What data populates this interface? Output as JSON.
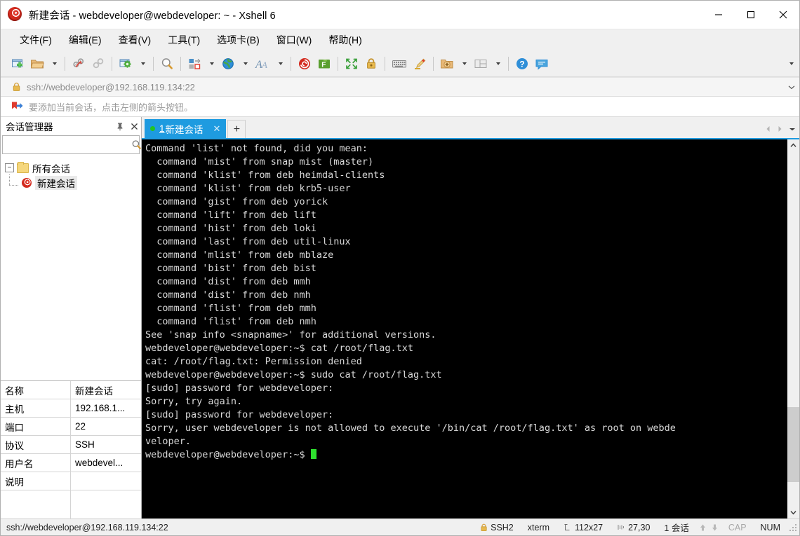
{
  "window": {
    "title": "新建会话 - webdeveloper@webdeveloper: ~ - Xshell 6",
    "app_icon": "xshell-spiral-icon",
    "minimize_label": "最小化",
    "maximize_label": "最大化",
    "close_label": "关闭"
  },
  "menubar": {
    "items": [
      {
        "label": "文件(F)",
        "name": "menu-file"
      },
      {
        "label": "编辑(E)",
        "name": "menu-edit"
      },
      {
        "label": "查看(V)",
        "name": "menu-view"
      },
      {
        "label": "工具(T)",
        "name": "menu-tools"
      },
      {
        "label": "选项卡(B)",
        "name": "menu-tabs"
      },
      {
        "label": "窗口(W)",
        "name": "menu-window"
      },
      {
        "label": "帮助(H)",
        "name": "menu-help"
      }
    ]
  },
  "toolbar": {
    "buttons": [
      {
        "name": "new-session-icon",
        "tooltip": "新建"
      },
      {
        "name": "open-folder-icon",
        "tooltip": "打开"
      },
      {
        "name": "disconnect-icon",
        "tooltip": "断开"
      },
      {
        "name": "reconnect-icon",
        "tooltip": "重新连接"
      },
      {
        "name": "session-properties-icon",
        "tooltip": "属性"
      },
      {
        "name": "find-icon",
        "tooltip": "查找"
      },
      {
        "name": "file-transfer-icon",
        "tooltip": "传输"
      },
      {
        "name": "globe-icon",
        "tooltip": "编码"
      },
      {
        "name": "font-icon",
        "tooltip": "字体"
      },
      {
        "name": "xshell-icon",
        "tooltip": "Xshell"
      },
      {
        "name": "xftp-icon",
        "tooltip": "Xftp"
      },
      {
        "name": "fullscreen-icon",
        "tooltip": "全屏"
      },
      {
        "name": "lock-icon",
        "tooltip": "锁定"
      },
      {
        "name": "keyboard-icon",
        "tooltip": "键盘"
      },
      {
        "name": "highlight-icon",
        "tooltip": "高亮"
      },
      {
        "name": "add-folder-icon",
        "tooltip": "新建文件夹"
      },
      {
        "name": "layout-icon",
        "tooltip": "排列"
      },
      {
        "name": "help-icon",
        "tooltip": "帮助"
      },
      {
        "name": "chat-icon",
        "tooltip": "聊天"
      }
    ],
    "overflow_label": "更多"
  },
  "address_bar": {
    "icon": "lock-icon",
    "value": "ssh://webdeveloper@192.168.119.134:22",
    "placeholder": "ssh://",
    "dropdown_icon": "chevron-down-icon"
  },
  "notice_bar": {
    "icon": "bookmark-arrow-icon",
    "text": "要添加当前会话，点击左侧的箭头按钮。"
  },
  "session_manager": {
    "title": "会话管理器",
    "pin_icon": "pin-icon",
    "close_icon": "close-icon",
    "search": {
      "value": "",
      "placeholder": "",
      "icon": "search-icon"
    },
    "tree": {
      "root": {
        "label": "所有会话",
        "expander": "−",
        "icon": "folder-icon"
      },
      "children": [
        {
          "label": "新建会话",
          "icon": "session-spiral-icon",
          "selected": true
        }
      ]
    },
    "properties": [
      {
        "key": "名称",
        "value": "新建会话"
      },
      {
        "key": "主机",
        "value": "192.168.1..."
      },
      {
        "key": "端口",
        "value": "22"
      },
      {
        "key": "协议",
        "value": "SSH"
      },
      {
        "key": "用户名",
        "value": "webdevel..."
      },
      {
        "key": "说明",
        "value": ""
      },
      {
        "key": "",
        "value": ""
      }
    ]
  },
  "tabs": {
    "items": [
      {
        "number": "1",
        "label": "新建会话",
        "active": true,
        "status": "connected",
        "close_icon": "close-icon"
      }
    ],
    "add_label": "+",
    "nav_prev_icon": "chevron-left-icon",
    "nav_next_icon": "chevron-right-icon",
    "nav_list_icon": "chevron-down-icon"
  },
  "terminal": {
    "lines": [
      "Command 'list' not found, did you mean:",
      "",
      "  command 'mist' from snap mist (master)",
      "  command 'klist' from deb heimdal-clients",
      "  command 'klist' from deb krb5-user",
      "  command 'gist' from deb yorick",
      "  command 'lift' from deb lift",
      "  command 'hist' from deb loki",
      "  command 'last' from deb util-linux",
      "  command 'mlist' from deb mblaze",
      "  command 'bist' from deb bist",
      "  command 'dist' from deb mmh",
      "  command 'dist' from deb nmh",
      "  command 'flist' from deb mmh",
      "  command 'flist' from deb nmh",
      "",
      "See 'snap info <snapname>' for additional versions.",
      "",
      "webdeveloper@webdeveloper:~$ cat /root/flag.txt",
      "cat: /root/flag.txt: Permission denied",
      "webdeveloper@webdeveloper:~$ sudo cat /root/flag.txt",
      "[sudo] password for webdeveloper:",
      "Sorry, try again.",
      "[sudo] password for webdeveloper:",
      "Sorry, user webdeveloper is not allowed to execute '/bin/cat /root/flag.txt' as root on webde",
      "veloper."
    ],
    "prompt": "webdeveloper@webdeveloper:~$ ",
    "cursor": "block",
    "bg_color": "#000000",
    "fg_color": "#d9d9d9",
    "cursor_color": "#2ee02e",
    "scroll_up_icon": "chevron-up-icon",
    "scroll_down_icon": "chevron-down-icon"
  },
  "statusbar": {
    "url": "ssh://webdeveloper@192.168.119.134:22",
    "security": {
      "icon": "lock-icon",
      "label": "SSH2"
    },
    "term_type": "xterm",
    "size": {
      "icon": "size-icon",
      "label": "112x27"
    },
    "cursor_pos": {
      "icon": "pos-icon",
      "label": "27,30"
    },
    "sessions": "1 会话",
    "up_icon": "arrow-up-icon",
    "down_icon": "arrow-down-icon",
    "caps": "CAP",
    "num": "NUM",
    "grip": "resize-grip-icon"
  },
  "colors": {
    "accent": "#1e9be0",
    "titlebar_bg": "#ffffff",
    "chrome_bg": "#f0f0f0",
    "terminal_bg": "#000000",
    "status_green": "#23c423"
  }
}
